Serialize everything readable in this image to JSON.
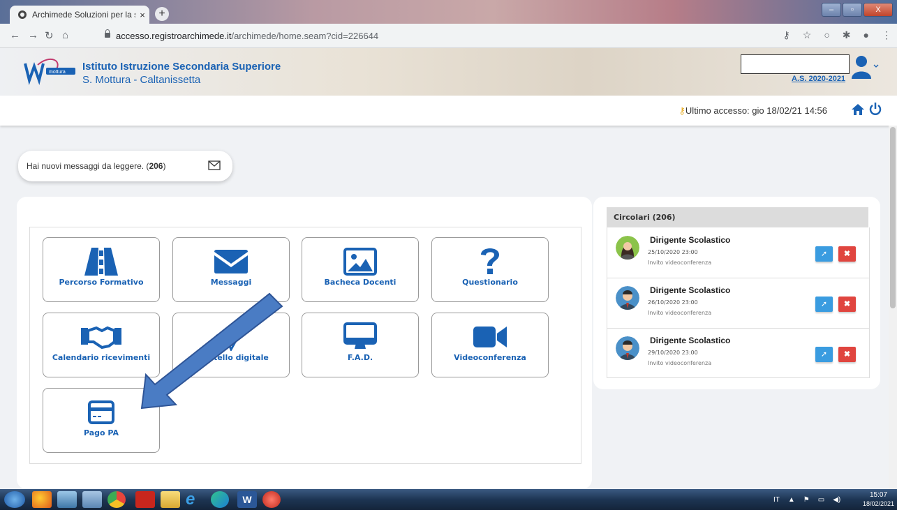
{
  "browser": {
    "tab_title": "Archimede Soluzioni per la scuol",
    "tab_close": "×",
    "new_tab": "+",
    "url_host": "accesso.registroarchimede.it",
    "url_path": "/archimede/home.seam?cid=226644",
    "window_buttons": {
      "minimize": "–",
      "maximize": "▫",
      "close": "X"
    }
  },
  "header": {
    "school_line1": "Istituto Istruzione Secondaria Superiore",
    "school_line2": "S. Mottura - Caltanissetta",
    "school_year": "A.S. 2020-2021",
    "last_access": "Ultimo accesso: gio 18/02/21 14:56"
  },
  "messages": {
    "notice": "Hai nuovi messaggi da leggere. (",
    "count": "206",
    "notice_end": ")"
  },
  "tiles": [
    {
      "label": "Percorso Formativo",
      "icon": "road-icon"
    },
    {
      "label": "Messaggi",
      "icon": "envelope-icon"
    },
    {
      "label": "Bacheca Docenti",
      "icon": "image-icon"
    },
    {
      "label": "Questionario",
      "icon": "question-icon"
    },
    {
      "label": "Calendario ricevimenti",
      "icon": "handshake-icon"
    },
    {
      "label": "Sportello digitale",
      "icon": "send-icon"
    },
    {
      "label": "F.A.D.",
      "icon": "monitor-icon"
    },
    {
      "label": "Videoconferenza",
      "icon": "video-icon"
    },
    {
      "label": "Pago PA",
      "icon": "credit-card-icon"
    }
  ],
  "circolari": {
    "title": "Circolari (206)",
    "items": [
      {
        "author": "Dirigente Scolastico",
        "date": "25/10/2020 23:00",
        "subject": "Invito videoconferenza",
        "avatar": "female"
      },
      {
        "author": "Dirigente Scolastico",
        "date": "26/10/2020 23:00",
        "subject": "Invito videoconferenza",
        "avatar": "male"
      },
      {
        "author": "Dirigente Scolastico",
        "date": "29/10/2020 23:00",
        "subject": "Invito videoconferenza",
        "avatar": "male"
      }
    ],
    "send_label": "➚",
    "delete_label": "✖"
  },
  "taskbar": {
    "lang": "IT",
    "time": "15:07",
    "date": "18/02/2021"
  },
  "colors": {
    "brand_blue": "#1a62b4",
    "send_button": "#3a9ce0",
    "delete_button": "#e0453f",
    "arrow": "#4a7cc4"
  }
}
